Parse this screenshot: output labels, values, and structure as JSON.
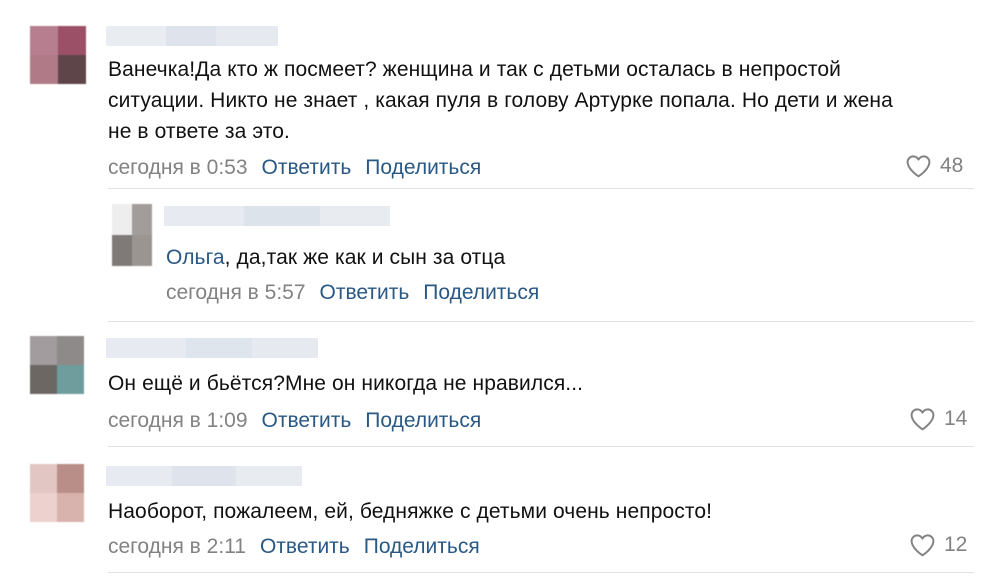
{
  "colors": {
    "link": "#2a5885",
    "meta": "#828282",
    "text": "#111111",
    "divider": "#e1e3e6"
  },
  "comments": [
    {
      "text": "Ванечка!Да кто ж посмеет? женщина и так с детьми осталась в непростой ситуации. Никто не знает , какая пуля в голову Артурке попала. Но дети и жена не в ответе за это.",
      "time": "сегодня в 0:53",
      "reply_label": "Ответить",
      "share_label": "Поделиться",
      "likes": "48"
    },
    {
      "mention": "Ольга",
      "text": ", да,так же как и сын за отца",
      "time": "сегодня в 5:57",
      "reply_label": "Ответить",
      "share_label": "Поделиться"
    },
    {
      "text": "Он ещё и бьётся?Мне он никогда не нравился...",
      "time": "сегодня в 1:09",
      "reply_label": "Ответить",
      "share_label": "Поделиться",
      "likes": "14"
    },
    {
      "text": "Наоборот, пожалеем, ей, бедняжке с детьми очень непросто!",
      "time": "сегодня в 2:11",
      "reply_label": "Ответить",
      "share_label": "Поделиться",
      "likes": "12"
    }
  ]
}
